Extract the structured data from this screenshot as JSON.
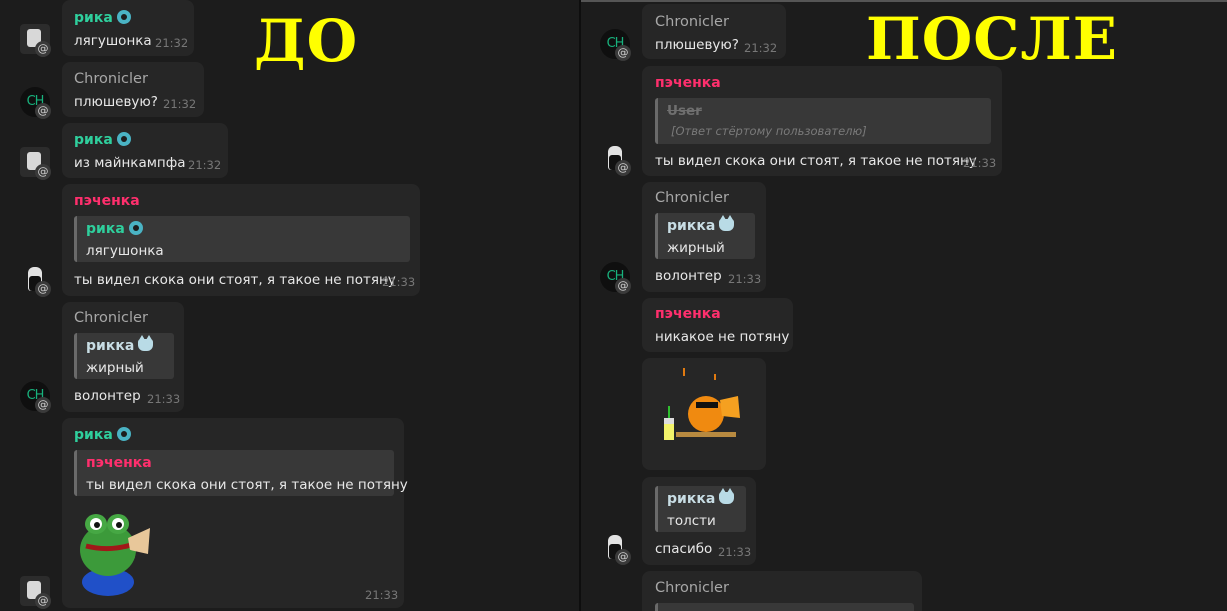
{
  "left": {
    "title": "ДО",
    "messages": [
      {
        "sender": "рика",
        "text": "лягушонка",
        "time": "21:32"
      },
      {
        "sender": "Chronicler",
        "text": "плюшевую?",
        "time": "21:32"
      },
      {
        "sender": "рика",
        "text": "из майнкампфа",
        "time": "21:32"
      },
      {
        "sender": "пэченка",
        "reply_sender": "рика",
        "reply_text": "лягушонка",
        "text": "ты видел скока они стоят, я такое не потяну",
        "time": "21:33"
      },
      {
        "sender": "Chronicler",
        "reply_sender": "рикка",
        "reply_text": "жирный",
        "text": "волонтер",
        "time": "21:33"
      },
      {
        "sender": "рика",
        "reply_sender": "пэченка",
        "reply_text": "ты видел скока они стоят, я такое не потяну",
        "sticker": "frog-sticker",
        "time": "21:33"
      }
    ],
    "avatar_ch": "CH"
  },
  "right": {
    "title": "ПОСЛЕ",
    "messages": [
      {
        "sender": "Chronicler",
        "text": "плюшевую?",
        "time": "21:32"
      },
      {
        "sender": "пэченка",
        "reply_sender": "User",
        "reply_text": "[Ответ стёртому пользователю]",
        "text": "ты видел скока они стоят, я такое не потяну",
        "time": "21:33"
      },
      {
        "sender": "Chronicler",
        "reply_sender": "рикка",
        "reply_text": "жирный",
        "text": "волонтер",
        "time": "21:33"
      },
      {
        "sender": "пэченка",
        "text": "никакое не потяну"
      },
      {
        "sticker": "sunbathing-duck-sticker"
      },
      {
        "reply_sender": "рикка",
        "reply_text": "толсти",
        "text": "спасибо",
        "time": "21:33"
      },
      {
        "sender": "Chronicler"
      }
    ],
    "avatar_ch": "CH"
  },
  "colors": {
    "green_name": "#2fcf9d",
    "pink_name": "#ff2f6d",
    "title": "#ffff00",
    "bubble": "#262626"
  }
}
